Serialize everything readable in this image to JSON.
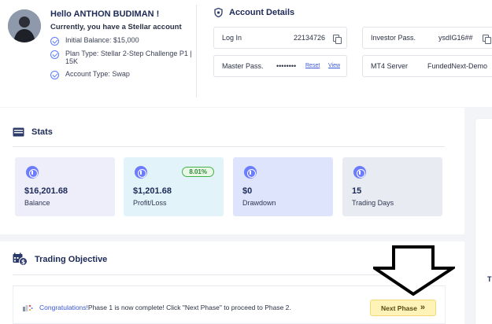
{
  "profile": {
    "greeting": "Hello ANTHON BUDIMAN !",
    "current": "Currently, you have a Stellar account",
    "items": [
      {
        "icon": "check-circle-icon",
        "text": "Initial Balance: $15,000"
      },
      {
        "icon": "check-circle-icon",
        "text_line1": "Plan Type: Stellar 2-Step Challenge P1 |",
        "text_line2": "15K"
      },
      {
        "icon": "check-circle-icon",
        "text": "Account Type: Swap"
      }
    ]
  },
  "account": {
    "title": "Account Details",
    "login": {
      "label": "Log In",
      "value": "22134726"
    },
    "investor": {
      "label": "Investor Pass.",
      "value": "ysdIG16##"
    },
    "master": {
      "label": "Master Pass.",
      "value": "••••••••",
      "reset": "Reset",
      "view": "View"
    },
    "server": {
      "label": "MT4 Server",
      "value": "FundedNext-Demo"
    }
  },
  "stats": {
    "title": "Stats",
    "cards": [
      {
        "value": "$16,201.68",
        "label": "Balance",
        "bg": "#eeeefb"
      },
      {
        "value": "$1,201.68",
        "label": "Profit/Loss",
        "badge": "8.01%",
        "bg": "#e2f4fa"
      },
      {
        "value": "$0",
        "label": "Drawdown",
        "bg": "#dde4fb"
      },
      {
        "value": "15",
        "label": "Trading Days",
        "bg": "#e8ecf2"
      }
    ]
  },
  "objective": {
    "title": "Trading Objective",
    "congrats": "Congratulations!",
    "message": "Phase 1 is now complete! Click \"Next Phase\" to proceed to Phase 2.",
    "next_button": "Next Phase",
    "next_icon": "»"
  },
  "side_panel": {
    "letter": "T"
  },
  "colors": {
    "accent": "#5c7cff",
    "title": "#1d2a57",
    "button_bg": "#fff3b8"
  }
}
